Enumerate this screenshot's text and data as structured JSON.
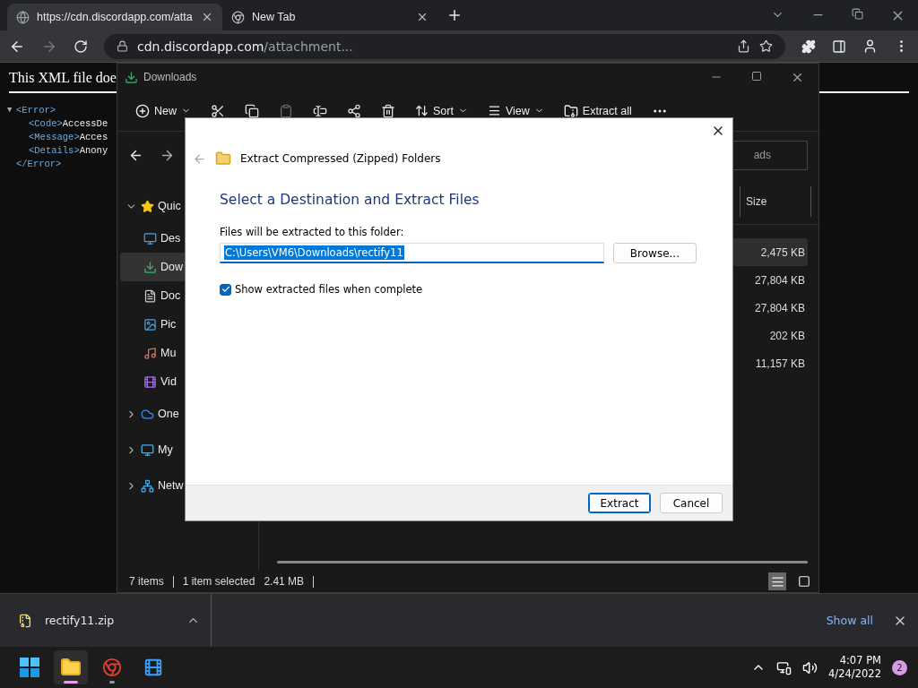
{
  "browser": {
    "tabs": [
      {
        "kind": "web",
        "label": "https://cdn.discordapp.com/atta",
        "selected": true
      },
      {
        "kind": "newtab",
        "label": "New Tab",
        "selected": false
      }
    ],
    "address": {
      "host": "cdn.discordapp.com",
      "path": "/attachment..."
    }
  },
  "xml_page": {
    "heading": "This XML file doe",
    "lines": [
      {
        "toggle": "▼",
        "tag": "<Error>",
        "children": [
          {
            "tag": "<Code>",
            "text": "AccessDe"
          },
          {
            "tag": "<Message>",
            "text": "Acces"
          },
          {
            "tag": "<Details>",
            "text": "Anony"
          }
        ]
      },
      {
        "tag": "</Error>"
      }
    ]
  },
  "explorer": {
    "title": "Downloads",
    "toolbar": {
      "new": "New",
      "sort": "Sort",
      "view": "View",
      "extract_all": "Extract all"
    },
    "search": {
      "placeholder": "ads"
    },
    "sidebar": [
      {
        "kind": "star",
        "label": "Quic",
        "expanded": true,
        "selected": false,
        "children": [
          {
            "kind": "desktop",
            "label": "Des",
            "selected": false
          },
          {
            "kind": "downloads",
            "label": "Dow",
            "selected": true
          },
          {
            "kind": "documents",
            "label": "Doc",
            "selected": false
          },
          {
            "kind": "pictures",
            "label": "Pic",
            "selected": false
          },
          {
            "kind": "music",
            "label": "Mu",
            "selected": false
          },
          {
            "kind": "videos",
            "label": "Vid",
            "selected": false
          }
        ]
      },
      {
        "kind": "cloud",
        "label": "One",
        "expanded": false,
        "selected": false
      },
      {
        "kind": "pc",
        "label": "My",
        "expanded": false,
        "selected": false
      },
      {
        "kind": "network",
        "label": "Netw",
        "expanded": false,
        "selected": false
      }
    ],
    "columns": [
      "Size"
    ],
    "rows": [
      {
        "size": "2,475 KB",
        "selected": true
      },
      {
        "size": "27,804 KB",
        "selected": false
      },
      {
        "size": "27,804 KB",
        "selected": false
      },
      {
        "size": "202 KB",
        "selected": false
      },
      {
        "size": "11,157 KB",
        "selected": false
      }
    ],
    "status": {
      "items": "7 items",
      "selected": "1 item selected",
      "size": "2.41 MB",
      "view_buttons": [
        {
          "kind": "details",
          "selected": true
        },
        {
          "kind": "tiles",
          "selected": false
        }
      ]
    }
  },
  "dialog": {
    "title": "Extract Compressed (Zipped) Folders",
    "heading": "Select a Destination and Extract Files",
    "label": "Files will be extracted to this folder:",
    "path": "C:\\Users\\VM6\\Downloads\\rectify11",
    "browse": "Browse...",
    "show_files": {
      "label": "Show extracted files when complete",
      "checked": true
    },
    "buttons": [
      {
        "label": "Extract",
        "default": true
      },
      {
        "label": "Cancel",
        "default": false
      }
    ]
  },
  "download_bar": {
    "file": "rectify11.zip",
    "show_all": "Show all"
  },
  "taskbar": {
    "apps": [
      {
        "kind": "start",
        "running": false,
        "selected": false
      },
      {
        "kind": "explorer",
        "running": true,
        "selected": true
      },
      {
        "kind": "chrome",
        "running": true,
        "selected": false
      },
      {
        "kind": "app",
        "running": false,
        "selected": false
      }
    ],
    "time": "4:07 PM",
    "date": "4/24/2022",
    "notifications": "2"
  }
}
